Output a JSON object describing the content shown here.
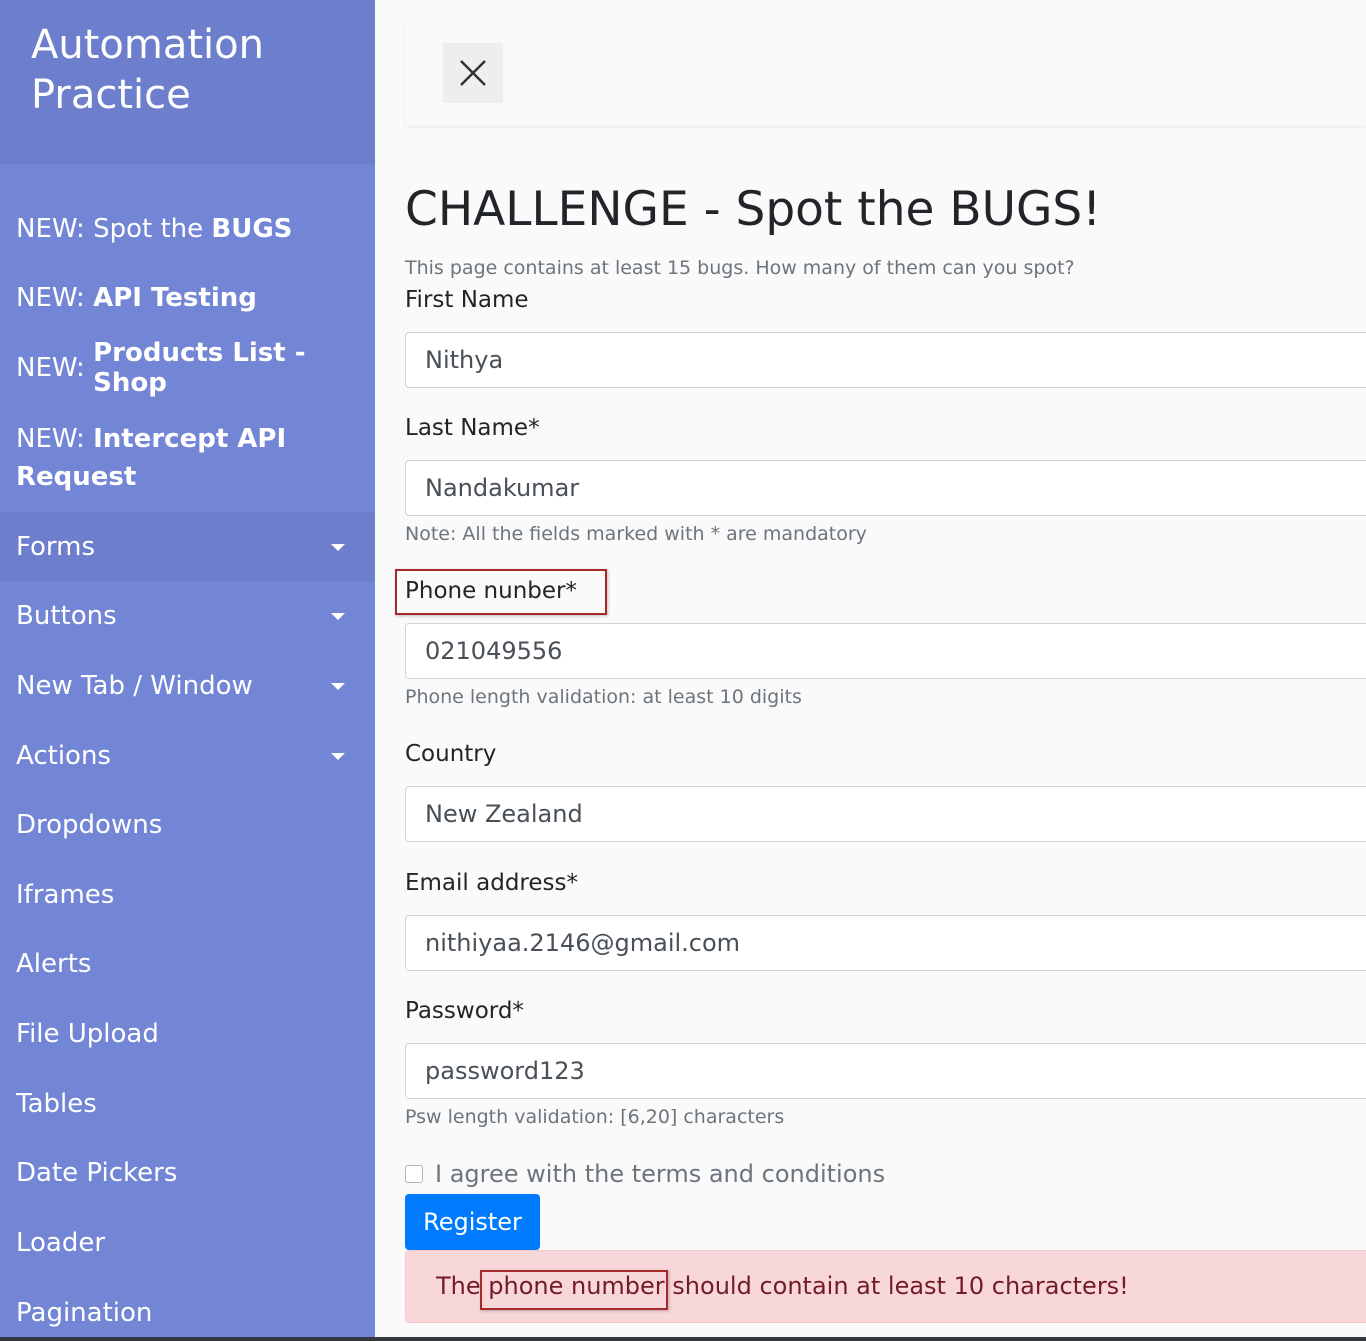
{
  "sidebar": {
    "brand_line1": "Automation",
    "brand_line2": "Practice",
    "items": [
      {
        "prefix": "NEW: Spot the ",
        "bold": "BUGS"
      },
      {
        "prefix": "NEW: ",
        "bold": "API Testing"
      },
      {
        "prefix": "NEW: ",
        "bold": "Products List - Shop"
      },
      {
        "prefix": "NEW: ",
        "bold_line1": "Intercept API",
        "bold_line2": "Request"
      },
      {
        "label": "Forms"
      },
      {
        "label": "Buttons"
      },
      {
        "label": "New Tab / Window"
      },
      {
        "label": "Actions"
      },
      {
        "label": "Dropdowns"
      },
      {
        "label": "Iframes"
      },
      {
        "label": "Alerts"
      },
      {
        "label": "File Upload"
      },
      {
        "label": "Tables"
      },
      {
        "label": "Date Pickers"
      },
      {
        "label": "Loader"
      },
      {
        "label": "Pagination"
      }
    ]
  },
  "topbar": {
    "close_icon": "close-icon"
  },
  "main": {
    "title": "CHALLENGE - Spot the BUGS!",
    "subtitle": "This page contains at least 15 bugs. How many of them can you spot?",
    "first_name_label": "First Name",
    "first_name_value": "Nithya",
    "last_name_label": "Last Name*",
    "last_name_value": "Nandakumar",
    "mandatory_note": "Note: All the fields marked with * are mandatory",
    "phone_label": "Phone nunber*",
    "phone_value": "021049556",
    "phone_hint": "Phone length validation: at least 10 digits",
    "country_label": "Country",
    "country_value": "New Zealand",
    "email_label": "Email address*",
    "email_value": "nithiyaa.2146@gmail.com",
    "password_label": "Password*",
    "password_value": "password123",
    "password_hint": "Psw length validation: [6,20] characters",
    "terms_label": "I agree with the terms and conditions",
    "register_label": "Register",
    "alert_prefix": "The ",
    "alert_highlight": "phone number",
    "alert_suffix": " should contain at least 10 characters!"
  },
  "colors": {
    "sidebar_bg": "#7386d5",
    "sidebar_header_bg": "#6d7fcc",
    "primary": "#007bff",
    "alert_bg": "#f8d7da",
    "alert_text": "#721c24",
    "bug_highlight": "#a52a2a"
  }
}
